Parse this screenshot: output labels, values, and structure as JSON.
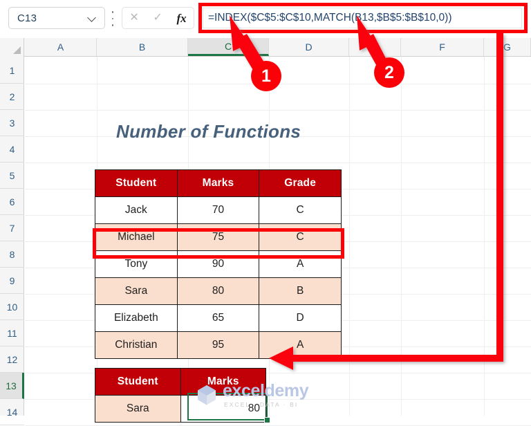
{
  "formula_bar": {
    "name_box_value": "C13",
    "name_box_placeholder": "Name Box",
    "cancel_icon": "close-icon",
    "confirm_icon": "check-icon",
    "function_icon": "fx",
    "formula": "=INDEX($C$5:$C$10,MATCH(B13,$B$5:$B$10,0))"
  },
  "grid": {
    "columns": [
      "A",
      "B",
      "C",
      "D",
      "E",
      "F",
      "G"
    ],
    "selected_column": "C",
    "rows": [
      "1",
      "2",
      "3",
      "4",
      "5",
      "6",
      "7",
      "8",
      "9",
      "10",
      "11",
      "12",
      "13",
      "14"
    ],
    "selected_row": "13"
  },
  "sheet": {
    "title": "Number of Functions"
  },
  "main_table": {
    "headers": [
      "Student",
      "Marks",
      "Grade"
    ],
    "rows": [
      {
        "student": "Jack",
        "marks": "70",
        "grade": "C"
      },
      {
        "student": "Michael",
        "marks": "75",
        "grade": "C"
      },
      {
        "student": "Tony",
        "marks": "90",
        "grade": "A"
      },
      {
        "student": "Sara",
        "marks": "80",
        "grade": "B"
      },
      {
        "student": "Elizabeth",
        "marks": "65",
        "grade": "D"
      },
      {
        "student": "Christian",
        "marks": "95",
        "grade": "A"
      }
    ]
  },
  "result_table": {
    "headers": [
      "Student",
      "Marks"
    ],
    "row": {
      "student": "Sara",
      "marks": "80"
    }
  },
  "annotations": {
    "badge_1": "1",
    "badge_2": "2"
  },
  "watermark": {
    "name": "exceldemy",
    "tagline": "EXCEL · DATA · BI"
  },
  "colors": {
    "header_red": "#c00006",
    "row_peach": "#fbdfce",
    "annotation_red": "#fb0007",
    "selection_green": "#1b7544",
    "title_blue": "#47617c"
  }
}
